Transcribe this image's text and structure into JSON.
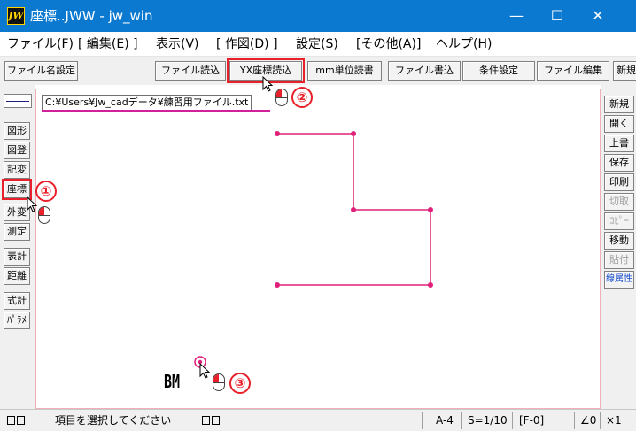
{
  "app": {
    "icon_text": "JW",
    "title": "座標..JWW - jw_win"
  },
  "window_controls": {
    "minimize": "—",
    "maximize": "☐",
    "close": "✕"
  },
  "menu": [
    "ファイル(F)",
    "[ 編集(E) ]",
    "表示(V)",
    "[ 作図(D) ]",
    "設定(S)",
    "[その他(A)]",
    "ヘルプ(H)"
  ],
  "toolbar": {
    "filename_settings": "ファイル名設定",
    "file_read": "ファイル読込",
    "yx_coord_read": "YX座標読込",
    "mm_unit_read": "mm単位読書",
    "file_write": "ファイル書込",
    "condition_settings": "条件設定",
    "file_edit": "ファイル編集",
    "new": "新規"
  },
  "left_tools": [
    "図形",
    "図登",
    "記変",
    "座標",
    "外変",
    "測定",
    "表計",
    "距離",
    "式計",
    "ﾊﾟﾗﾒ"
  ],
  "right_tools": [
    {
      "label": "新規",
      "state": "normal"
    },
    {
      "label": "開く",
      "state": "normal"
    },
    {
      "label": "上書",
      "state": "normal"
    },
    {
      "label": "保存",
      "state": "normal"
    },
    {
      "label": "印刷",
      "state": "normal"
    },
    {
      "label": "切取",
      "state": "disabled"
    },
    {
      "label": "ｺﾋﾟｰ",
      "state": "disabled"
    },
    {
      "label": "移動",
      "state": "normal"
    },
    {
      "label": "貼付",
      "state": "disabled"
    },
    {
      "label": "線属性",
      "state": "active"
    }
  ],
  "canvas": {
    "file_path": "C:¥Users¥Jw_cadデータ¥練習用ファイル.txt",
    "bm_label": "BM",
    "line_color": "#e0207a",
    "marker_color": "#e0207a"
  },
  "annotations": {
    "step1": "①",
    "step2": "②",
    "step3": "③",
    "highlight_color": "#e8202a"
  },
  "status": {
    "message": "項目を選択してください",
    "paper": "A-4",
    "scale": "S=1/10",
    "layer": "[F-0]",
    "angle": "∠0",
    "zoom": "×1"
  },
  "colors": {
    "titlebar": "#0b79d0",
    "chrome": "#f0f0f0"
  }
}
